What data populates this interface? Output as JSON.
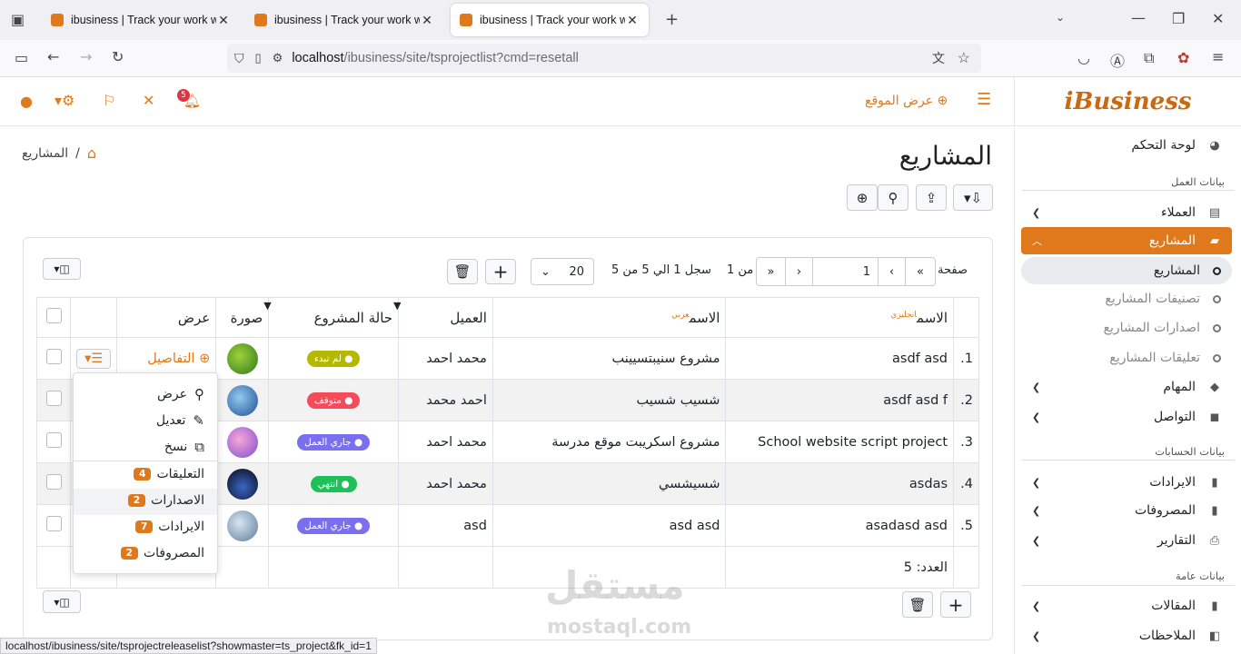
{
  "browser": {
    "tabs": [
      {
        "title": "ibusiness | Track your work with"
      },
      {
        "title": "ibusiness | Track your work with"
      },
      {
        "title": "ibusiness | Track your work with"
      }
    ],
    "url_host": "localhost",
    "url_path": "/ibusiness/site/tsprojectlist?cmd=resetall",
    "status_url": "localhost/ibusiness/site/tsprojectreleaselist?showmaster=ts_project&fk_id=1"
  },
  "header": {
    "view_site": "عرض الموقع",
    "notifications_count": "5"
  },
  "logo": {
    "text": "iBusiness"
  },
  "sidebar": {
    "dashboard": "لوحة التحكم",
    "work_data_heading": "بيانات العمل",
    "customers": "العملاء",
    "projects": "المشاريع",
    "sub_projects": "المشاريع",
    "sub_categories": "تصنيفات المشاريع",
    "sub_releases": "اصدارات المشاريع",
    "sub_comments": "تعليقات المشاريع",
    "tasks": "المهام",
    "communication": "التواصل",
    "accounts_heading": "بيانات الحسابات",
    "revenues": "الايرادات",
    "expenses": "المصروفات",
    "reports": "التقارير",
    "general_heading": "بيانات عامة",
    "articles": "المقالات",
    "notes": "الملاحظات"
  },
  "page": {
    "title": "المشاريع",
    "breadcrumb_current": "المشاريع",
    "breadcrumb_sep": "/"
  },
  "pager": {
    "page_label": "صفحة",
    "page_value": "1",
    "of_label": "من 1",
    "records": "سجل 1 الي 5 من 5",
    "page_size": "20"
  },
  "table": {
    "headers": {
      "name_en": "الاسم",
      "name_en_tag": "انجليزي",
      "name_ar": "الاسم",
      "name_ar_tag": "عربي",
      "customer": "العميل",
      "status": "حالة المشروع",
      "image": "صورة",
      "view": "عرض"
    },
    "rows": [
      {
        "num": "1.",
        "name_en": "asdf asd",
        "name_ar": "مشروع سنيبتسيينب",
        "customer": "محمد احمد",
        "status": "لم تبدء",
        "status_color": "#b5b800",
        "details": "التفاصيل"
      },
      {
        "num": "2.",
        "name_en": "asdf asd f",
        "name_ar": "شسيب شسيب",
        "customer": "احمد محمد",
        "status": "متوقف",
        "status_color": "#f44c5a",
        "details": ""
      },
      {
        "num": "3.",
        "name_en": "School website script project",
        "name_ar": "مشروع اسكريبت موقع مدرسة",
        "customer": "محمد احمد",
        "status": "جاري العمل",
        "status_color": "#7a6ff0",
        "details": ""
      },
      {
        "num": "4.",
        "name_en": "asdas",
        "name_ar": "شسيشسي",
        "customer": "محمد احمد",
        "status": "انتهي",
        "status_color": "#1fbf5a",
        "details": ""
      },
      {
        "num": "5.",
        "name_en": "asadasd asd",
        "name_ar": "asd asd",
        "customer": "asd",
        "status": "جاري العمل",
        "status_color": "#7a6ff0",
        "details": ""
      }
    ],
    "count_label": "العدد: 5"
  },
  "dropdown": {
    "view": "عرض",
    "edit": "تعديل",
    "copy": "نسخ",
    "comments": "التعليقات",
    "comments_count": "4",
    "releases": "الاصدارات",
    "releases_count": "2",
    "revenues": "الايرادات",
    "revenues_count": "7",
    "expenses": "المصروفات",
    "expenses_count": "2"
  },
  "watermark": {
    "ar": "مستقل",
    "en": "mostaql.com"
  },
  "colors": {
    "accent": "#e0791c"
  }
}
